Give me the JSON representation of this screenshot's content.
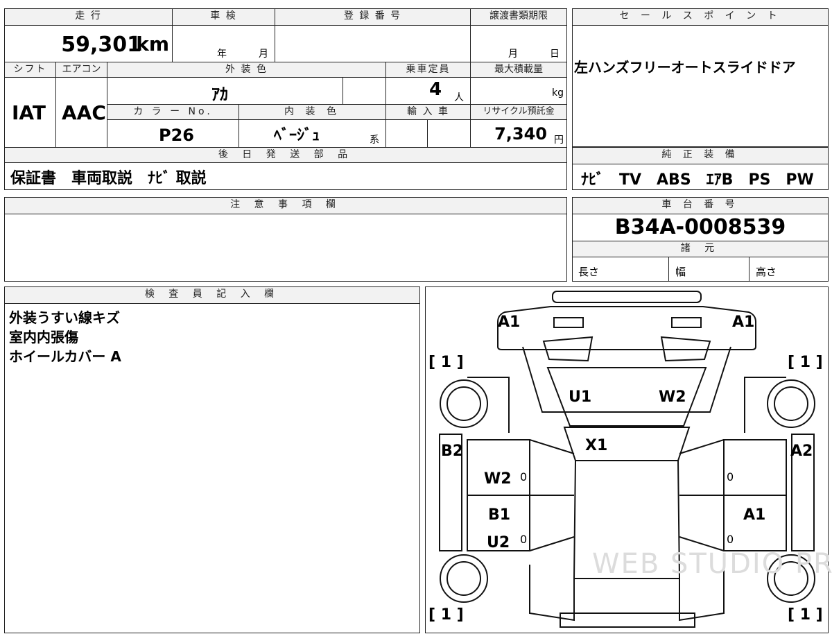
{
  "top_table": {
    "mileage_label": "走 行",
    "mileage_value": "59,301",
    "mileage_unit": "km",
    "inspection_label": "車 検",
    "inspection_year": "年",
    "inspection_month": "月",
    "registration_label": "登 録 番 号",
    "transfer_label": "譲渡書類期限",
    "transfer_month": "月",
    "transfer_day": "日",
    "shift_label": "シフト",
    "shift_value": "IAT",
    "aircon_label": "エアコン",
    "aircon_value": "AAC",
    "exterior_color_label": "外 装 色",
    "exterior_color_value": "ｱｶ",
    "capacity_label": "乗車定員",
    "capacity_value": "4",
    "capacity_unit": "人",
    "max_load_label": "最大積載量",
    "max_load_unit": "kg",
    "color_no_label": "カ ラ ー No.",
    "color_no_value": "P26",
    "interior_color_label": "内 装 色",
    "interior_color_value": "ﾍﾞｰｼﾞｭ",
    "interior_color_suffix": "系",
    "import_label": "輸 入 車",
    "recycle_label": "リサイクル預託金",
    "recycle_value": "7,340",
    "recycle_unit": "円",
    "later_parts_label": "後 日 発 送 部 品",
    "later_parts_value": "保証書　車両取説　ﾅﾋﾞ 取説"
  },
  "sale_points": {
    "label": "セ ー ル ス ポ イ ン ト",
    "value": "左ハンズフリーオートスライドドア"
  },
  "equipment": {
    "label": "純 正 装 備",
    "value": "ﾅﾋﾞ　TV　ABS　ｴｱB　PS　PW"
  },
  "notes": {
    "label": "注 意 事 項 欄"
  },
  "chassis": {
    "label": "車 台 番 号",
    "value": "B34A-0008539",
    "specs_label": "諸 元",
    "length_label": "長さ",
    "width_label": "幅",
    "height_label": "高さ"
  },
  "inspector": {
    "label": "検 査 員 記 入 欄",
    "lines": [
      "外装うすい線キズ",
      "室内内張傷",
      "ホイールカバー A"
    ]
  },
  "diagram": {
    "marks": {
      "front_left": "A1",
      "front_right": "A1",
      "roof_left": "U1",
      "roof_right": "W2",
      "hood": "X1",
      "left_side": "B2",
      "right_side": "A2",
      "left_front_door": "W2",
      "left_rear_door_1": "B1",
      "left_rear_door_2": "U2",
      "right_rear_door": "A1"
    },
    "tires": {
      "front_left": "[ 1 ]",
      "front_right": "[ 1 ]",
      "rear_left": "[ 1 ]",
      "rear_right": "[ 1 ]"
    },
    "zeros": [
      "0",
      "0",
      "0",
      "0"
    ],
    "watermark": "WEB STUDIO PRO"
  }
}
